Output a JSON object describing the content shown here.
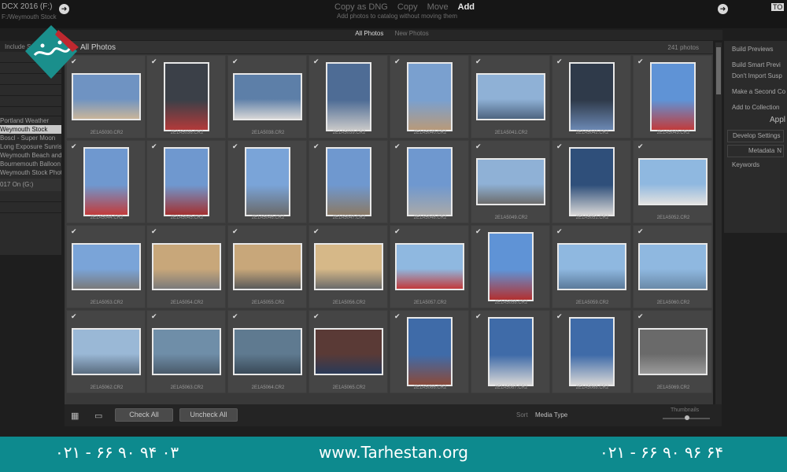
{
  "topbar": {
    "source_title": "DCX 2016 (F:)",
    "source_path": "F:/Weymouth Stock",
    "modes": [
      "Copy as DNG",
      "Copy",
      "Move",
      "Add"
    ],
    "mode_description": "Add photos to catalog without moving them",
    "to_label": "TO"
  },
  "left_panel": {
    "include_label": "Include Su",
    "folders": [
      "Portland Weather",
      "Weymouth Stock",
      "Boscl - Super Moon",
      "Long Exposure Sunris...",
      "Weymouth Beach and ...",
      "Bournemouth Balloon",
      "Weymouth Stock Phot..."
    ],
    "selected_folder": "Weymouth Stock",
    "extra_item": "017 On (G:)"
  },
  "view_tabs": [
    "All Photos",
    "New Photos"
  ],
  "grid": {
    "title": "All Photos",
    "count": "241 photos",
    "filenames": [
      "2E1A5030.CR2",
      "2E1A5036.CR2",
      "2E1A5038.CR2",
      "2E1A5039.CR2",
      "2E1A5040.CR2",
      "2E1A5041.CR2",
      "2E1A5042.CR2",
      "2E1A5043.CR2",
      "2E1A5044.CR2",
      "2E1A5045.CR2",
      "2E1A5046.CR2",
      "2E1A5047.CR2",
      "2E1A5048.CR2",
      "2E1A5049.CR2",
      "2E1A5051.CR2",
      "2E1A5052.CR2",
      "2E1A5053.CR2",
      "2E1A5054.CR2",
      "2E1A5055.CR2",
      "2E1A5056.CR2",
      "2E1A5057.CR2",
      "2E1A5058.CR2",
      "2E1A5059.CR2",
      "2E1A5060.CR2",
      "2E1A5062.CR2",
      "2E1A5063.CR2",
      "2E1A5064.CR2",
      "2E1A5065.CR2",
      "2E1A5066.CR2",
      "2E1A5067.CR2",
      "2E1A5068.CR2",
      "2E1A5069.CR2"
    ],
    "checked_count": 32
  },
  "right_panel": {
    "rows": [
      "Build Previews",
      "Build Smart Previ",
      "Don't Import Susp",
      "Make a Second Co",
      "Add to Collection"
    ],
    "apply_heading": "Appl",
    "develop_label": "Develop Settings",
    "develop_value": "N",
    "metadata_label": "Metadata",
    "metadata_value": "N",
    "keywords_label": "Keywords"
  },
  "bottom_bar": {
    "check_all": "Check All",
    "uncheck_all": "Uncheck All",
    "sort_label": "Sort",
    "sort_value": "Media Type",
    "thumbnails_label": "Thumbnails"
  },
  "footer": {
    "phone_left": "۰۲۱ - ۶۶ ۹۰ ۹۴ ۰۳",
    "website": "www.Tarhestan.org",
    "phone_right": "۰۲۱ - ۶۶ ۹۰ ۹۶ ۶۴"
  },
  "colors": {
    "footer_bg": "#0d8a8e",
    "logo_teal": "#1a8f8c",
    "logo_red": "#c0282f",
    "selected_folder_bg": "#c9c9c9"
  }
}
